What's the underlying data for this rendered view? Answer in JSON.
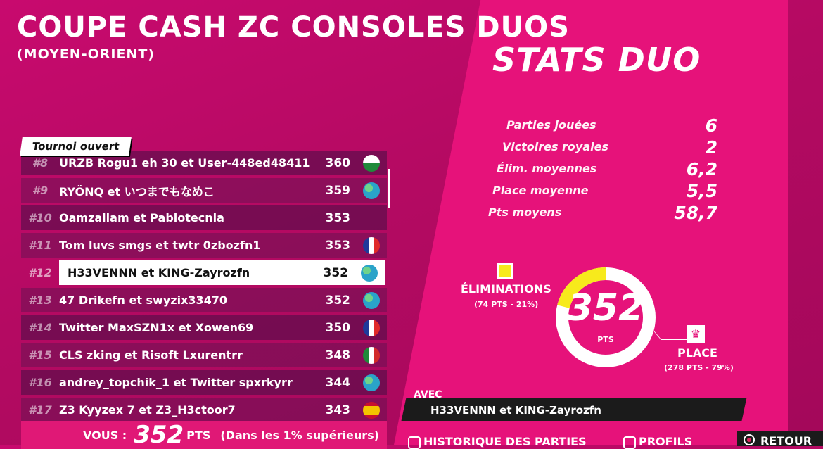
{
  "header": {
    "title": "COUPE CASH ZC CONSOLES DUOS",
    "subtitle": "(MOYEN-ORIENT)",
    "stats_title": "STATS DUO"
  },
  "leaderboard": {
    "tag": "Tournoi ouvert",
    "rows": [
      {
        "rank": "#8",
        "team": "URZB Rogu1 eh 30 et User-448ed48411",
        "score": "360",
        "flag": "wales-flag"
      },
      {
        "rank": "#9",
        "team": "RYÖNQ et いつまでもなめこ",
        "score": "359",
        "flag": "globe-icon"
      },
      {
        "rank": "#10",
        "team": "Oamzallam et Pablotecnia",
        "score": "353",
        "flag": ""
      },
      {
        "rank": "#11",
        "team": "Tom luvs smgs et twtr 0zbozfn1",
        "score": "353",
        "flag": "france-flag"
      },
      {
        "rank": "#12",
        "team": "H33VENNN et KING-Zayrozfn",
        "score": "352",
        "flag": "globe-icon"
      },
      {
        "rank": "#13",
        "team": "47 Drikefn et swyzix33470",
        "score": "352",
        "flag": "globe-icon"
      },
      {
        "rank": "#14",
        "team": "Twitter MaxSZN1x et Xowen69",
        "score": "350",
        "flag": "france-flag"
      },
      {
        "rank": "#15",
        "team": "CLS zking et Risoft Lxurentrr",
        "score": "348",
        "flag": "italy-flag"
      },
      {
        "rank": "#16",
        "team": "andrey_topchik_1 et Twitter spxrkyrr",
        "score": "344",
        "flag": "globe-icon"
      },
      {
        "rank": "#17",
        "team": "Z3 Kyyzex 7 et Z3_H3ctoor7",
        "score": "343",
        "flag": "spain-flag"
      }
    ],
    "you": {
      "label": "VOUS :",
      "score": "352",
      "pts": "PTS",
      "note": "(Dans les 1% supérieurs)"
    }
  },
  "stats": [
    {
      "label": "Parties jouées",
      "value": "6"
    },
    {
      "label": "Victoires royales",
      "value": "2"
    },
    {
      "label": "Élim. moyennes",
      "value": "6,2"
    },
    {
      "label": "Place moyenne",
      "value": "5,5"
    },
    {
      "label": "Pts moyens",
      "value": "58,7"
    }
  ],
  "donut": {
    "total": "352",
    "pts_label": "PTS",
    "elim_label": "ÉLIMINATIONS",
    "elim_sub": "(74 PTS - 21%)",
    "elim_fraction": 0.21,
    "place_label": "PLACE",
    "place_sub": "(278 PTS - 79%)",
    "colors": {
      "elim": "#f7ea1c",
      "place": "#ffffff"
    }
  },
  "partner": {
    "label": "AVEC",
    "name": "H33VENNN et KING-Zayrozfn"
  },
  "footer": {
    "history": "HISTORIQUE DES PARTIES",
    "profiles": "PROFILS",
    "back": "RETOUR"
  }
}
